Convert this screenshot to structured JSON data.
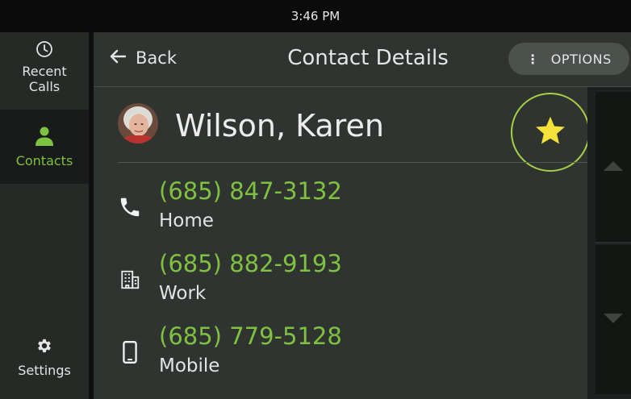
{
  "status_bar": {
    "time": "3:46 PM"
  },
  "sidebar": {
    "items": [
      {
        "label": "Recent Calls",
        "icon": "clock-icon"
      },
      {
        "label": "Contacts",
        "icon": "person-icon",
        "active": true
      },
      {
        "label": "Settings",
        "icon": "gear-icon"
      }
    ]
  },
  "topbar": {
    "back_label": "Back",
    "title": "Contact Details",
    "options_label": "OPTIONS"
  },
  "contact": {
    "name": "Wilson, Karen",
    "favorite": true,
    "phones": [
      {
        "number": "(685) 847-3132",
        "type": "Home",
        "icon": "phone-icon"
      },
      {
        "number": "(685) 882-9193",
        "type": "Work",
        "icon": "building-icon"
      },
      {
        "number": "(685) 779-5128",
        "type": "Mobile",
        "icon": "mobile-icon"
      }
    ]
  },
  "colors": {
    "accent_green": "#7fc241",
    "favorite_star": "#f4e13a",
    "favorite_ring": "#a6d144",
    "panel_bg": "#2f3430",
    "sidebar_bg": "#262a27"
  }
}
